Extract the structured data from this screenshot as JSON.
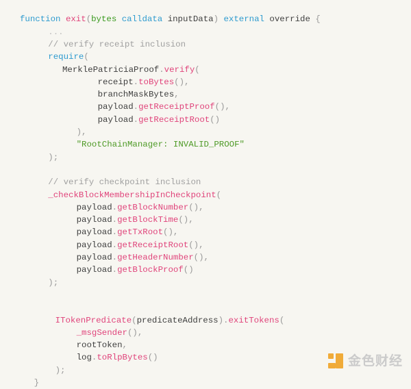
{
  "editor": {
    "language": "solidity",
    "background_color": "#f7f6f1",
    "font_size_px": 12.4,
    "line_height_px": 18.3,
    "palette": {
      "keyword": "#2e9bcf",
      "function_name": "#e0447b",
      "type": "#3a9a1f",
      "identifier": "#3f3f3f",
      "punctuation": "#9a9a9a",
      "comment": "#a0a0a0",
      "string": "#4e9a26",
      "ellipsis": "#bdbdbd"
    }
  },
  "code": {
    "lines": [
      {
        "indent": 0,
        "tokens": [
          {
            "t": "function",
            "c": "kw"
          },
          {
            "t": " ",
            "c": "plain"
          },
          {
            "t": "exit",
            "c": "fnname"
          },
          {
            "t": "(",
            "c": "punct"
          },
          {
            "t": "bytes",
            "c": "type"
          },
          {
            "t": " ",
            "c": "plain"
          },
          {
            "t": "calldata",
            "c": "kw"
          },
          {
            "t": " ",
            "c": "plain"
          },
          {
            "t": "inputData",
            "c": "plain"
          },
          {
            "t": ")",
            "c": "punct"
          },
          {
            "t": " ",
            "c": "plain"
          },
          {
            "t": "external",
            "c": "kw"
          },
          {
            "t": " ",
            "c": "plain"
          },
          {
            "t": "override",
            "c": "plain"
          },
          {
            "t": " ",
            "c": "plain"
          },
          {
            "t": "{",
            "c": "punct"
          }
        ]
      },
      {
        "indent": 4,
        "tokens": [
          {
            "t": "...",
            "c": "dim"
          }
        ]
      },
      {
        "indent": 4,
        "tokens": [
          {
            "t": "// verify receipt inclusion",
            "c": "comment"
          }
        ]
      },
      {
        "indent": 4,
        "tokens": [
          {
            "t": "require",
            "c": "kw"
          },
          {
            "t": "(",
            "c": "punct"
          }
        ]
      },
      {
        "indent": 6,
        "tokens": [
          {
            "t": "MerklePatriciaProof",
            "c": "plain"
          },
          {
            "t": ".",
            "c": "punct"
          },
          {
            "t": "verify",
            "c": "fnname"
          },
          {
            "t": "(",
            "c": "punct"
          }
        ]
      },
      {
        "indent": 11,
        "tokens": [
          {
            "t": "receipt",
            "c": "plain"
          },
          {
            "t": ".",
            "c": "punct"
          },
          {
            "t": "toBytes",
            "c": "fnname"
          },
          {
            "t": "(),",
            "c": "punct"
          }
        ]
      },
      {
        "indent": 11,
        "tokens": [
          {
            "t": "branchMaskBytes",
            "c": "plain"
          },
          {
            "t": ",",
            "c": "punct"
          }
        ]
      },
      {
        "indent": 11,
        "tokens": [
          {
            "t": "payload",
            "c": "plain"
          },
          {
            "t": ".",
            "c": "punct"
          },
          {
            "t": "getReceiptProof",
            "c": "fnname"
          },
          {
            "t": "(),",
            "c": "punct"
          }
        ]
      },
      {
        "indent": 11,
        "tokens": [
          {
            "t": "payload",
            "c": "plain"
          },
          {
            "t": ".",
            "c": "punct"
          },
          {
            "t": "getReceiptRoot",
            "c": "fnname"
          },
          {
            "t": "()",
            "c": "punct"
          }
        ]
      },
      {
        "indent": 8,
        "tokens": [
          {
            "t": "),",
            "c": "punct"
          }
        ]
      },
      {
        "indent": 8,
        "tokens": [
          {
            "t": "\"RootChainManager: INVALID_PROOF\"",
            "c": "string"
          }
        ]
      },
      {
        "indent": 4,
        "tokens": [
          {
            "t": ");",
            "c": "punct"
          }
        ]
      },
      {
        "indent": 0,
        "tokens": []
      },
      {
        "indent": 4,
        "tokens": [
          {
            "t": "// verify checkpoint inclusion",
            "c": "comment"
          }
        ]
      },
      {
        "indent": 4,
        "tokens": [
          {
            "t": "_checkBlockMembershipInCheckpoint",
            "c": "fnname"
          },
          {
            "t": "(",
            "c": "punct"
          }
        ]
      },
      {
        "indent": 8,
        "tokens": [
          {
            "t": "payload",
            "c": "plain"
          },
          {
            "t": ".",
            "c": "punct"
          },
          {
            "t": "getBlockNumber",
            "c": "fnname"
          },
          {
            "t": "(),",
            "c": "punct"
          }
        ]
      },
      {
        "indent": 8,
        "tokens": [
          {
            "t": "payload",
            "c": "plain"
          },
          {
            "t": ".",
            "c": "punct"
          },
          {
            "t": "getBlockTime",
            "c": "fnname"
          },
          {
            "t": "(),",
            "c": "punct"
          }
        ]
      },
      {
        "indent": 8,
        "tokens": [
          {
            "t": "payload",
            "c": "plain"
          },
          {
            "t": ".",
            "c": "punct"
          },
          {
            "t": "getTxRoot",
            "c": "fnname"
          },
          {
            "t": "(),",
            "c": "punct"
          }
        ]
      },
      {
        "indent": 8,
        "tokens": [
          {
            "t": "payload",
            "c": "plain"
          },
          {
            "t": ".",
            "c": "punct"
          },
          {
            "t": "getReceiptRoot",
            "c": "fnname"
          },
          {
            "t": "(),",
            "c": "punct"
          }
        ]
      },
      {
        "indent": 8,
        "tokens": [
          {
            "t": "payload",
            "c": "plain"
          },
          {
            "t": ".",
            "c": "punct"
          },
          {
            "t": "getHeaderNumber",
            "c": "fnname"
          },
          {
            "t": "(),",
            "c": "punct"
          }
        ]
      },
      {
        "indent": 8,
        "tokens": [
          {
            "t": "payload",
            "c": "plain"
          },
          {
            "t": ".",
            "c": "punct"
          },
          {
            "t": "getBlockProof",
            "c": "fnname"
          },
          {
            "t": "()",
            "c": "punct"
          }
        ]
      },
      {
        "indent": 4,
        "tokens": [
          {
            "t": ");",
            "c": "punct"
          }
        ]
      },
      {
        "indent": 0,
        "tokens": []
      },
      {
        "indent": 0,
        "tokens": []
      },
      {
        "indent": 5,
        "tokens": [
          {
            "t": "ITokenPredicate",
            "c": "fnname"
          },
          {
            "t": "(",
            "c": "punct"
          },
          {
            "t": "predicateAddress",
            "c": "plain"
          },
          {
            "t": ")",
            "c": "punct"
          },
          {
            "t": ".",
            "c": "punct"
          },
          {
            "t": "exitTokens",
            "c": "fnname"
          },
          {
            "t": "(",
            "c": "punct"
          }
        ]
      },
      {
        "indent": 8,
        "tokens": [
          {
            "t": "_msgSender",
            "c": "fnname"
          },
          {
            "t": "(),",
            "c": "punct"
          }
        ]
      },
      {
        "indent": 8,
        "tokens": [
          {
            "t": "rootToken",
            "c": "plain"
          },
          {
            "t": ",",
            "c": "punct"
          }
        ]
      },
      {
        "indent": 8,
        "tokens": [
          {
            "t": "log",
            "c": "plain"
          },
          {
            "t": ".",
            "c": "punct"
          },
          {
            "t": "toRlpBytes",
            "c": "fnname"
          },
          {
            "t": "()",
            "c": "punct"
          }
        ]
      },
      {
        "indent": 5,
        "tokens": [
          {
            "t": ");",
            "c": "punct"
          }
        ]
      },
      {
        "indent": 2,
        "tokens": [
          {
            "t": "}",
            "c": "punct"
          }
        ]
      }
    ]
  },
  "watermark": {
    "text": "金色财经",
    "mark_color": "#f0a830",
    "text_color": "#c9c9c9"
  }
}
